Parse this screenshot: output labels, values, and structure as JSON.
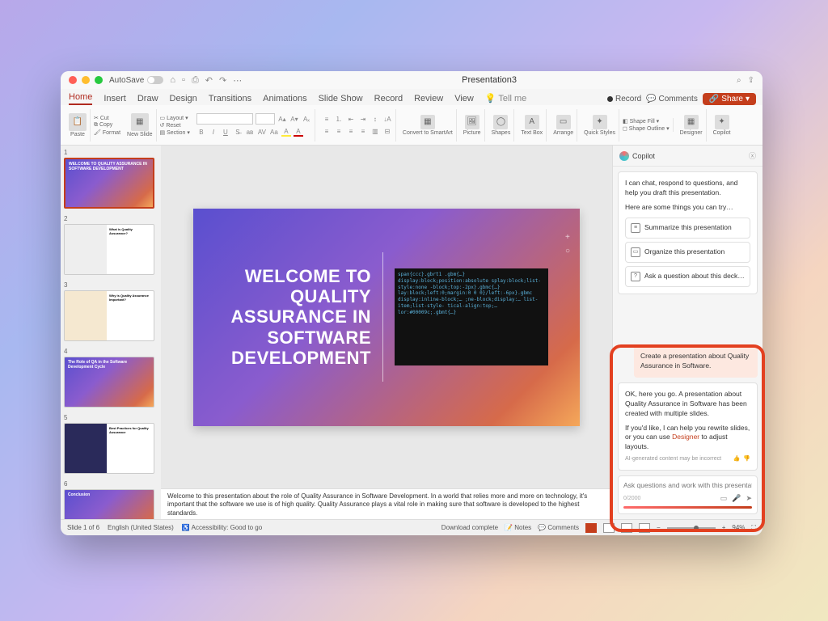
{
  "window": {
    "autosave": "AutoSave",
    "title": "Presentation3"
  },
  "ribbon_tabs": [
    "Home",
    "Insert",
    "Draw",
    "Design",
    "Transitions",
    "Animations",
    "Slide Show",
    "Record",
    "Review",
    "View",
    "Tell me"
  ],
  "ribbon_right": {
    "record": "Record",
    "comments": "Comments",
    "share": "Share"
  },
  "ribbon": {
    "paste": "Paste",
    "cut": "Cut",
    "copy": "Copy",
    "format": "Format",
    "new_slide": "New\nSlide",
    "layout": "Layout",
    "reset": "Reset",
    "section": "Section",
    "convert": "Convert to\nSmartArt",
    "picture": "Picture",
    "shapes": "Shapes",
    "text_box": "Text\nBox",
    "arrange": "Arrange",
    "quick_styles": "Quick\nStyles",
    "shape_fill": "Shape Fill",
    "shape_outline": "Shape Outline",
    "designer": "Designer",
    "copilot": "Copilot"
  },
  "thumbs": [
    {
      "n": "1",
      "title": "WELCOME TO QUALITY ASSURANCE IN SOFTWARE DEVELOPMENT"
    },
    {
      "n": "2",
      "title": "What is Quality Assurance?"
    },
    {
      "n": "3",
      "title": "Why is Quality Assurance Important?"
    },
    {
      "n": "4",
      "title": "The Role of QA in the Software Development Cycle"
    },
    {
      "n": "5",
      "title": "Best Practices for Quality Assurance"
    },
    {
      "n": "6",
      "title": "Conclusion"
    }
  ],
  "slide": {
    "title": "WELCOME TO QUALITY ASSURANCE IN SOFTWARE DEVELOPMENT",
    "code_lines": "span{ccc}.gbrt1 .gbm{…}\ndisplay:block;position:absolute\nsplay:block;list-style:none\n-block;top:-2px}.gbmc{…}\nlay:block;left:0;margin:0\n0 0}/left:-6px}.gbmc\ndisplay:inline-block;…\n;ne-block;display:…\nlist-item;list-style-\ntical-align:top;…\nlor:#00009c;.gbmt{…}"
  },
  "notes": "Welcome to this presentation about the role of Quality Assurance in Software Development. In a world that relies more and more on technology, it's important that the software we use is of high quality. Quality Assurance plays a vital role in making sure that software is developed to the highest standards.",
  "copilot": {
    "title": "Copilot",
    "intro": "I can chat, respond to questions, and help you draft this presentation.",
    "try": "Here are some things you can try…",
    "suggest1": "Summarize this presentation",
    "suggest2": "Organize this presentation",
    "suggest3": "Ask a question about this deck…",
    "user_prompt": "Create a presentation about Quality Assurance in Software.",
    "response1": "OK, here you go. A presentation about Quality Assurance in Software has been created with multiple slides.",
    "response2a": "If you'd like, I can help you rewrite slides, or you can use ",
    "response2b": "Designer",
    "response2c": " to adjust layouts.",
    "disclaimer": "AI-generated content may be incorrect",
    "placeholder": "Ask questions and work with this presentation",
    "counter": "0/2000"
  },
  "status": {
    "slide_count": "Slide 1 of 6",
    "lang": "English (United States)",
    "accessibility": "Accessibility: Good to go",
    "download": "Download complete",
    "notes": "Notes",
    "comments": "Comments",
    "zoom": "94%"
  }
}
